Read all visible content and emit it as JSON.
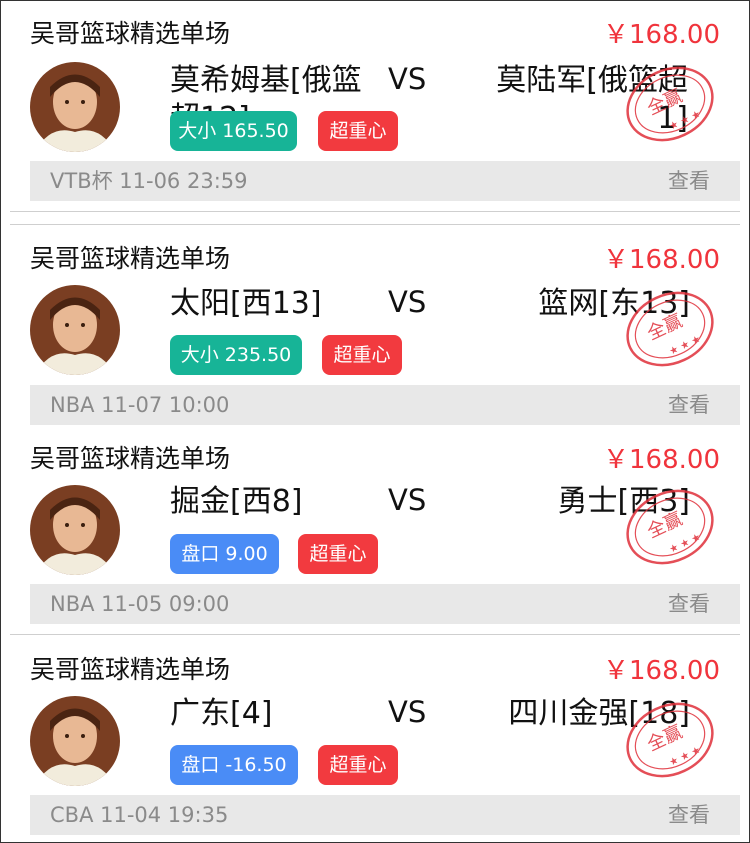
{
  "accent_price": "#f0343c",
  "items": [
    {
      "title": "吴哥篮球精选单场",
      "price": "￥168.00",
      "home": "莫希姆基[俄篮超12]",
      "vs": "VS",
      "away": "莫陆军[俄篮超1]",
      "tag": "大小 165.50",
      "tag_color": "#17b497",
      "badge": "超重心",
      "league_time": "VTB杯 11-06 23:59",
      "view": "查看",
      "stamp": "全赢"
    },
    {
      "title": "吴哥篮球精选单场",
      "price": "￥168.00",
      "home": "太阳[西13]",
      "vs": "VS",
      "away": "篮网[东13]",
      "tag": "大小 235.50",
      "tag_color": "#17b497",
      "badge": "超重心",
      "league_time": "NBA 11-07 10:00",
      "view": "查看",
      "stamp": "全赢"
    },
    {
      "title": "吴哥篮球精选单场",
      "price": "￥168.00",
      "home": "掘金[西8]",
      "vs": "VS",
      "away": "勇士[西3]",
      "tag": "盘口 9.00",
      "tag_color": "#4a8cf6",
      "badge": "超重心",
      "league_time": "NBA 11-05 09:00",
      "view": "查看",
      "stamp": "全赢"
    },
    {
      "title": "吴哥篮球精选单场",
      "price": "￥168.00",
      "home": "广东[4]",
      "vs": "VS",
      "away": "四川金强[18]",
      "tag": "盘口 -16.50",
      "tag_color": "#4a8cf6",
      "badge": "超重心",
      "league_time": "CBA 11-04 19:35",
      "view": "查看",
      "stamp": "全赢"
    }
  ]
}
